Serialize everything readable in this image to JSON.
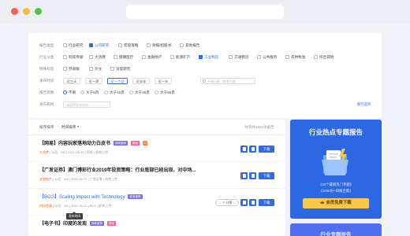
{
  "browser": {},
  "filters": {
    "report_type": {
      "label": "报告类型",
      "options": [
        {
          "text": "行业研究",
          "checked": false
        },
        {
          "text": "公司研究",
          "checked": true
        },
        {
          "text": "宏观策略",
          "checked": false
        },
        {
          "text": "财报/招股书",
          "checked": false
        },
        {
          "text": "其他报告",
          "checked": false
        }
      ]
    },
    "industry": {
      "label": "行业分类",
      "options": [
        {
          "text": "科技传媒",
          "checked": false
        },
        {
          "text": "大消费",
          "checked": false
        },
        {
          "text": "健康医疗",
          "checked": false
        },
        {
          "text": "金融地产",
          "checked": false
        },
        {
          "text": "能源矿产",
          "checked": false
        },
        {
          "text": "工业制造",
          "checked": true
        },
        {
          "text": "交通物流",
          "checked": false
        },
        {
          "text": "公共服务",
          "checked": false
        },
        {
          "text": "农林牧渔",
          "checked": false
        },
        {
          "text": "综合其他",
          "checked": false
        }
      ]
    },
    "tags": {
      "label": "特殊标签",
      "options": [
        {
          "text": "券商版",
          "checked": false
        },
        {
          "text": "外文",
          "checked": false
        },
        {
          "text": "深度研究",
          "checked": false
        }
      ]
    },
    "time": {
      "label": "发布时间",
      "chips": [
        "近三天",
        "近一周",
        "近一个月",
        "近半年",
        "近一年"
      ],
      "active_index": 2,
      "date_placeholder": "开始日期 - 结束日期"
    },
    "pages": {
      "label": "报告页数",
      "options": [
        {
          "text": "不限",
          "checked": true
        },
        {
          "text": "大于5页",
          "checked": false
        },
        {
          "text": "大于10页",
          "checked": false
        },
        {
          "text": "大于30页",
          "checked": false
        },
        {
          "text": "大于50页",
          "checked": false
        }
      ]
    },
    "org": {
      "label": "发布机构",
      "placeholder": "请选择发布机构"
    },
    "reset_label": "清空选项"
  },
  "results": {
    "sort_label": "排序排序",
    "sort_value": "时间排序",
    "total_text": "共有共4852条报告",
    "items": [
      {
        "title": "【网易】内容玩家落地动力白皮书",
        "badges": [
          "券商推荐",
          "原版",
          "A"
        ],
        "meta": [
          {
            "text": "大消费",
            "src": true
          },
          {
            "text": "34页 · 3M"
          },
          {
            "text": "2022-05-31"
          },
          {
            "text": "网易"
          },
          {
            "text": "机构上传"
          }
        ],
        "title_link": false,
        "share": false
      },
      {
        "title": "【广发证券】澳门博彩行业2019年投资策略：行业底部已经出现，对中场...",
        "badges": [],
        "meta": [
          {
            "text": "金融地产",
            "src": true
          },
          {
            "text": "34页 · 3M"
          },
          {
            "text": "2022-05-31"
          },
          {
            "text": "广发证券"
          },
          {
            "text": "机构上传"
          }
        ],
        "title_link": false,
        "share": false
      },
      {
        "title": "【BCG】Scaling Impact with Technology",
        "badges": [
          "券商推荐"
        ],
        "meta": [
          {
            "text": "科技传媒",
            "src": true
          },
          {
            "text": "30页 · 3M"
          },
          {
            "text": "2022-05-31"
          },
          {
            "text": "BCG"
          },
          {
            "text": "机构上传"
          }
        ],
        "title_link": true,
        "share": true
      },
      {
        "title": "【电子书】印度的发现",
        "badges": [
          "券商推荐",
          "原版"
        ],
        "meta": [],
        "title_link": false,
        "share": false
      }
    ],
    "share_label": "分享",
    "download_label": "下载",
    "tooltip": "发布时间"
  },
  "promo": {
    "title": "行业热点专题报告",
    "line1": "《30个最新热门专题》",
    "line2": "《1000份+研报合集》",
    "button": "会员免费下载",
    "title2": "行业专题报告"
  }
}
